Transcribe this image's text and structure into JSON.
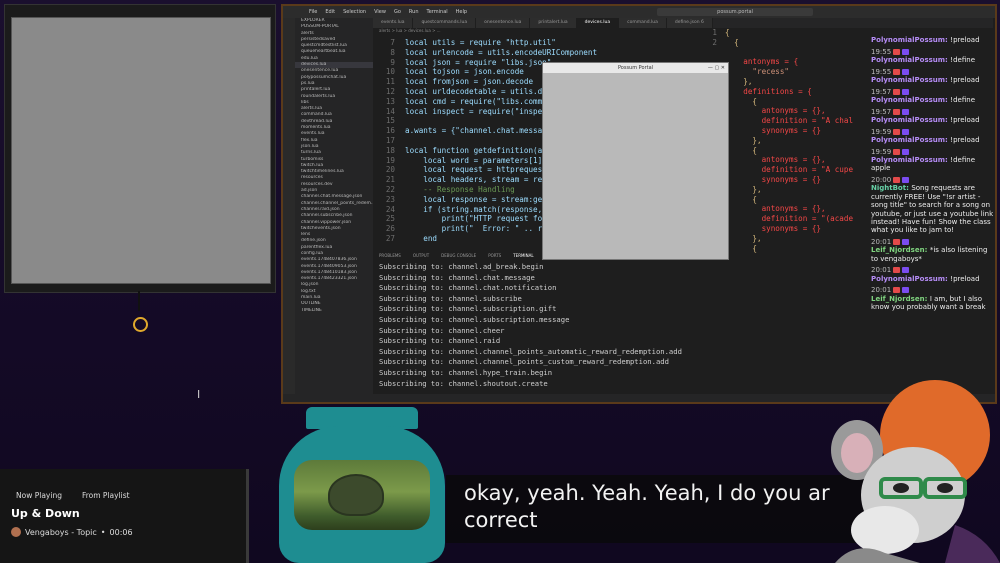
{
  "editor": {
    "menu": [
      "File",
      "Edit",
      "Selection",
      "View",
      "Go",
      "Run",
      "Terminal",
      "Help"
    ],
    "window_title": "possum.portal",
    "tabs": [
      "events.lua",
      "questcommands.lua",
      "onesentence.lua",
      "printalert.lua",
      "devices.lua",
      "command.lua",
      "define.json 6"
    ],
    "active_tab": "devices.lua",
    "breadcrumb": "alerts > lua > devices.lua > ...",
    "explorer_title": "EXPLORER",
    "explorer_items": [
      "POSSUM-PORTAL",
      "alerts",
      "persistedsaved",
      "questcmdtestlist.lua",
      "queueheartbeat.lua",
      "edu.lua",
      "devices.lua",
      "onesentence.lua",
      "polypossumchat.lua",
      "ps.lua",
      "printalert.lua",
      "roundalerts.lua",
      "libs",
      "alerts.lua",
      "command.lua",
      "devthread.lua",
      "moments.lua",
      "events.lua",
      "flex.lua",
      "json.lua",
      "turns.lua",
      "turbomiss",
      "twitch.lua",
      "twitchtimelines.lua",
      "resources",
      "resources.dev",
      "ad.json",
      "channel.chat.message.json",
      "channel.channel_points_redem...",
      "channel.raid.json",
      "channel.subscribe.json",
      "channel.vippower.json",
      "twitchevents.json",
      "lens",
      "define.json",
      "parentflex.lua",
      "config.lua",
      "events.1748407836.json",
      "events.1748409053.json",
      "events.1748410183.json",
      "events.1748423321.json",
      "log.json",
      "log.txt",
      "main.lua"
    ],
    "outline_label": "OUTLINE",
    "timeline_label": "TIMELINE",
    "code": [
      {
        "n": "7",
        "t": "local utils = require \"http.util\""
      },
      {
        "n": "8",
        "t": "local urlencode = utils.encodeURIComponent"
      },
      {
        "n": "9",
        "t": "local json = require \"libs.json\""
      },
      {
        "n": "10",
        "t": "local tojson = json.encode"
      },
      {
        "n": "11",
        "t": "local fromjson = json.decode"
      },
      {
        "n": "12",
        "t": "local urldecodetable = utils.dict_"
      },
      {
        "n": "13",
        "t": "local cmd = require(\"libs.command"
      },
      {
        "n": "14",
        "t": "local inspect = require(\"inspect\""
      },
      {
        "n": "15",
        "t": ""
      },
      {
        "n": "16",
        "t": "a.wants = {\"channel.chat.message\""
      },
      {
        "n": "17",
        "t": ""
      },
      {
        "n": "18",
        "t": "local function getdefinition(aler"
      },
      {
        "n": "19",
        "t": "    local word = parameters[1]"
      },
      {
        "n": "20",
        "t": "    local request = httprequest.ne"
      },
      {
        "n": "21",
        "t": "    local headers, stream = reque"
      },
      {
        "n": "22",
        "t": "    -- Response Handling"
      },
      {
        "n": "23",
        "t": "    local response = stream:get_bo"
      },
      {
        "n": "24",
        "t": "    if (string.match(response, \"[{"
      },
      {
        "n": "25",
        "t": "        print(\"HTTP request for de"
      },
      {
        "n": "26",
        "t": "        print(\"  Error: \" .. respo"
      },
      {
        "n": "27",
        "t": "    end"
      }
    ],
    "json_lines": [
      {
        "n": "1",
        "t": "{"
      },
      {
        "n": "2",
        "t": "  {"
      },
      {
        "n": "",
        "t": ""
      },
      {
        "n": "",
        "t": "    antonyms = {"
      },
      {
        "n": "",
        "t": "      \"recess\""
      },
      {
        "n": "",
        "t": "    },"
      },
      {
        "n": "",
        "t": "    definitions = {"
      },
      {
        "n": "",
        "t": "      {"
      },
      {
        "n": "",
        "t": "        antonyms = {},"
      },
      {
        "n": "",
        "t": "        definition = \"A chal"
      },
      {
        "n": "",
        "t": "        synonyms = {}"
      },
      {
        "n": "",
        "t": "      },"
      },
      {
        "n": "",
        "t": "      {"
      },
      {
        "n": "",
        "t": "        antonyms = {},"
      },
      {
        "n": "",
        "t": "        definition = \"A cupe"
      },
      {
        "n": "",
        "t": "        synonyms = {}"
      },
      {
        "n": "",
        "t": "      },"
      },
      {
        "n": "",
        "t": "      {"
      },
      {
        "n": "",
        "t": "        antonyms = {},"
      },
      {
        "n": "",
        "t": "        definition = \"(acade"
      },
      {
        "n": "",
        "t": "        synonyms = {}"
      },
      {
        "n": "",
        "t": "      },"
      },
      {
        "n": "",
        "t": "      {"
      }
    ],
    "panel_tabs": [
      "PROBLEMS",
      "OUTPUT",
      "DEBUG CONSOLE",
      "PORTS",
      "TERMINAL"
    ],
    "terminal": [
      "Subscribing to: channel.ad_break.begin",
      "Subscribing to: channel.chat.message",
      "Subscribing to: channel.chat.notification",
      "Subscribing to: channel.subscribe",
      "Subscribing to: channel.subscription.gift",
      "Subscribing to: channel.subscription.message",
      "Subscribing to: channel.cheer",
      "Subscribing to: channel.raid",
      "Subscribing to: channel.channel_points_automatic_reward_redemption.add",
      "Subscribing to: channel.channel_points_custom_reward_redemption.add",
      "Subscribing to: channel.hype_train.begin",
      "Subscribing to: channel.shoutout.create"
    ]
  },
  "portal_window": {
    "title": "Possum Portal",
    "controls": "— ▢ ✕"
  },
  "chat": [
    {
      "time": "",
      "user": "PolynomialPossum:",
      "text": "!preload",
      "color": "#b58cf5"
    },
    {
      "time": "19:55",
      "user": "PolynomialPossum:",
      "text": "!define",
      "color": "#b58cf5"
    },
    {
      "time": "19:55",
      "user": "PolynomialPossum:",
      "text": "!preload",
      "color": "#b58cf5"
    },
    {
      "time": "19:57",
      "user": "PolynomialPossum:",
      "text": "!define",
      "color": "#b58cf5"
    },
    {
      "time": "19:57",
      "user": "PolynomialPossum:",
      "text": "!preload",
      "color": "#b58cf5"
    },
    {
      "time": "19:59",
      "user": "PolynomialPossum:",
      "text": "!preload",
      "color": "#b58cf5"
    },
    {
      "time": "19:59",
      "user": "PolynomialPossum:",
      "text": "!define apple",
      "color": "#b58cf5"
    },
    {
      "time": "20:00",
      "user": "NightBot:",
      "text": "Song requests are currently FREE! Use \"!sr artist - song title\" to search for a song on youtube, or just use a youtube link instead! Have fun! Show the class what you like to jam to!",
      "color": "#66d1a6"
    },
    {
      "time": "20:01",
      "user": "Leif_Njordsen:",
      "text": "*is also listening to vengaboys*",
      "color": "#7fd37f"
    },
    {
      "time": "20:01",
      "user": "PolynomialPossum:",
      "text": "!preload",
      "color": "#b58cf5"
    },
    {
      "time": "20:01",
      "user": "Leif_Njordsen:",
      "text": "I am, but I also know you probably want a break",
      "color": "#7fd37f"
    }
  ],
  "player": {
    "tab_now_playing": "Now Playing",
    "tab_from_playlist": "From Playlist",
    "song": "Up & Down",
    "artist": "Vengaboys - Topic",
    "time": "00:06"
  },
  "caption": {
    "line1": "okay, yeah. Yeah. Yeah, I do you ar",
    "line2": "correct"
  },
  "misc": {
    "cursor_glyph": "I"
  }
}
